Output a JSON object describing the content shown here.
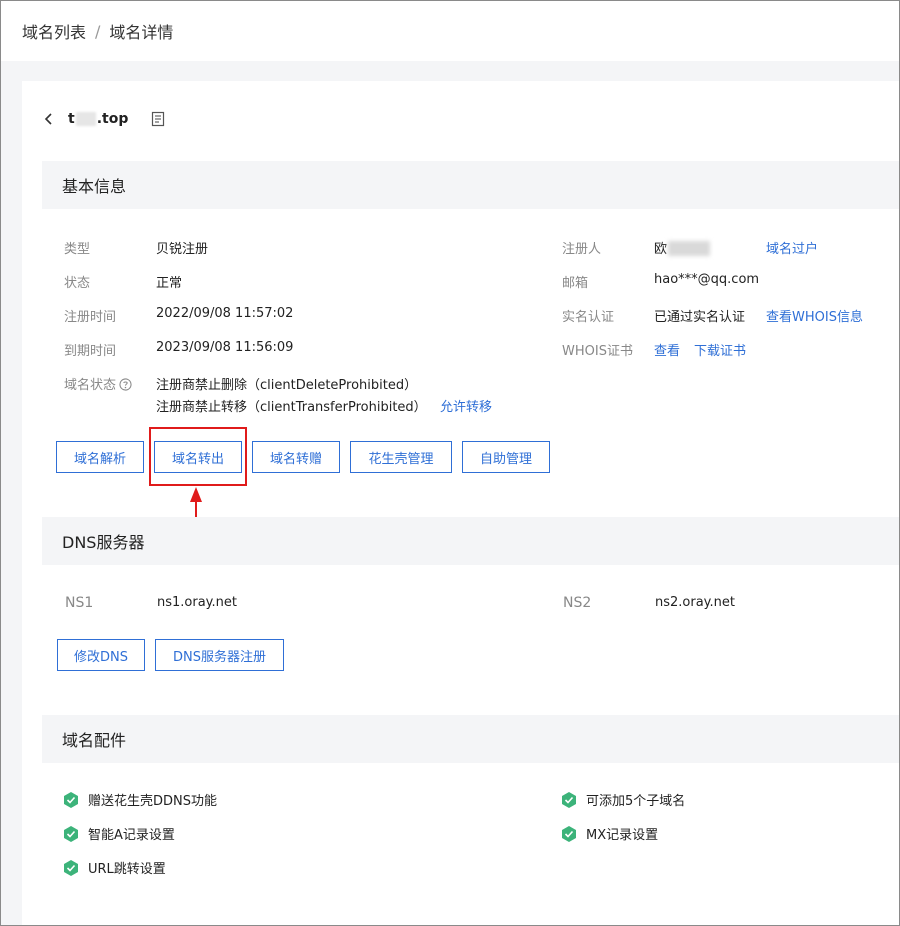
{
  "breadcrumb": {
    "root": "域名列表",
    "separator": "/",
    "current": "域名详情"
  },
  "domain": {
    "prefix": "t",
    "suffix": ".top"
  },
  "basic": {
    "title": "基本信息",
    "type_label": "类型",
    "type_value": "贝锐注册",
    "status_label": "状态",
    "status_value": "正常",
    "reg_time_label": "注册时间",
    "reg_time_value": "2022/09/08 11:57:02",
    "exp_time_label": "到期时间",
    "exp_time_value": "2023/09/08 11:56:09",
    "domain_status_label": "域名状态",
    "domain_status_1": "注册商禁止删除（clientDeleteProhibited）",
    "domain_status_2": "注册商禁止转移（clientTransferProhibited）",
    "allow_transfer_link": "允许转移",
    "registrant_label": "注册人",
    "registrant_value": "欧",
    "transfer_owner_link": "域名过户",
    "email_label": "邮箱",
    "email_value": "hao***@qq.com",
    "realname_label": "实名认证",
    "realname_value": "已通过实名认证",
    "whois_info_link": "查看WHOIS信息",
    "whois_cert_label": "WHOIS证书",
    "view_link": "查看",
    "download_cert_link": "下载证书"
  },
  "actions": {
    "resolve": "域名解析",
    "transfer_out": "域名转出",
    "gift": "域名转赠",
    "hsk": "花生壳管理",
    "self_manage": "自助管理"
  },
  "dns": {
    "title": "DNS服务器",
    "ns1_label": "NS1",
    "ns1_value": "ns1.oray.net",
    "ns2_label": "NS2",
    "ns2_value": "ns2.oray.net",
    "modify_btn": "修改DNS",
    "register_btn": "DNS服务器注册"
  },
  "addons": {
    "title": "域名配件",
    "items": [
      "赠送花生壳DDNS功能",
      "可添加5个子域名",
      "智能A记录设置",
      "MX记录设置",
      "URL跳转设置"
    ]
  },
  "colors": {
    "link": "#2f6fd6",
    "highlight": "#e01b1b",
    "addon_icon": "#3cb37a"
  }
}
